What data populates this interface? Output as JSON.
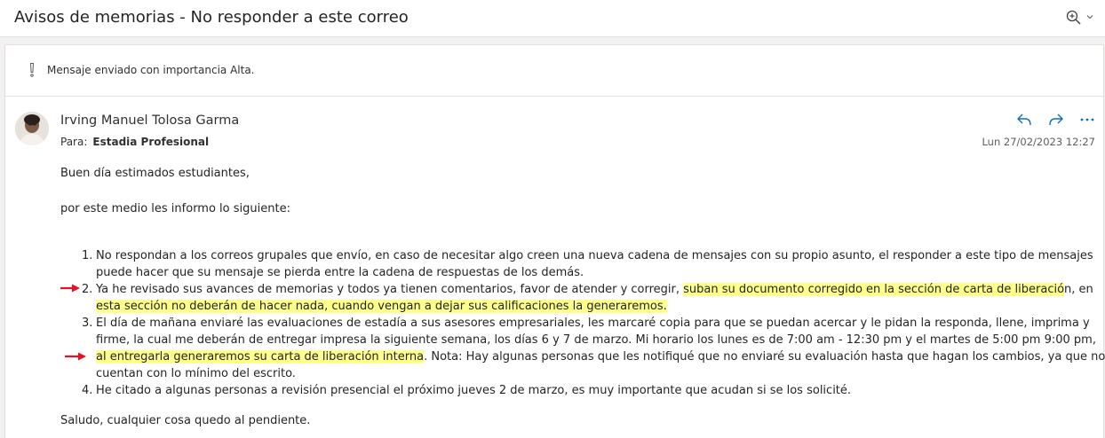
{
  "window": {
    "subject": "Avisos de memorias - No responder a este correo"
  },
  "importance": {
    "text": "Mensaje enviado con importancia Alta."
  },
  "message": {
    "sender": "Irving Manuel Tolosa Garma",
    "to_label": "Para:",
    "to_value": "Estadia Profesional",
    "date": "Lun 27/02/2023 12:27",
    "greeting": "Buen día estimados estudiantes,",
    "intro": "por este medio les informo lo siguiente:",
    "items": [
      {
        "number": "1.",
        "lines": [
          "No respondan a los correos grupales que envío, en caso de necesitar algo creen una nueva cadena de mensajes con su propio asunto, el responder a este tipo de mensajes",
          "puede hacer que su mensaje se pierda entre la cadena de respuestas de los demás."
        ]
      },
      {
        "number": "2.",
        "line1_pre": "Ya he revisado sus avances de memorias y todos ya tienen comentarios, favor de atender y corregir, ",
        "line1_hl": "suban su documento corregido en la sección de carta de liberació",
        "line1_post": "n, en",
        "line2_hl": "esta sección no deberán de hacer nada, cuando vengan a dejar sus calificaciones la generaremos."
      },
      {
        "number": "3.",
        "line1": "El día de mañana enviaré las evaluaciones de estadía a sus asesores empresariales, les marcaré copia para que se puedan acercar y le pidan la responda, llene, imprima y",
        "line2": "firme, la cual me deberán de entregar impresa la siguiente semana, los días 6 y 7 de marzo.  Mi horario los lunes es de 7:00 am - 12:30 pm y el martes de 5:00 pm 9:00 pm,",
        "line3_hl": "al entregarla generaremos su carta de liberación interna",
        "line3_post": ". Nota: Hay algunas personas que les notifiqué que no enviaré su evaluación hasta que hagan los cambios, ya que no",
        "line4": "cuentan con lo mínimo del escrito."
      },
      {
        "number": "4.",
        "line1": "He citado a algunas personas a revisión presencial el próximo jueves 2 de marzo, es muy importante que acudan si se los solicité."
      }
    ],
    "closing": "Saludo, cualquier cosa quedo al pendiente."
  },
  "icons": {
    "zoom": "zoom-icon",
    "zoom_menu": "chevron-down-icon",
    "importance": "exclamation-icon",
    "reply": "reply-icon",
    "forward": "forward-icon",
    "more": "more-icon",
    "annotation": "red-arrow-icon"
  },
  "colors": {
    "highlight": "#ffff8c",
    "accent": "#0f6cbd",
    "arrow": "#e81123"
  }
}
